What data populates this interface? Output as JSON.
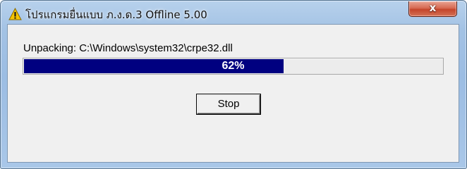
{
  "window": {
    "title": "โปรแกรมยื่นแบบ ภ.ง.ด.3  Offline 5.00",
    "close_label": "x",
    "title_icon": "warning-icon"
  },
  "dialog": {
    "status_text": "Unpacking: C:\\Windows\\system32\\crpe32.dll",
    "progress": {
      "value": 0.62,
      "label": "62%",
      "fill_color": "#000080"
    },
    "stop_label": "Stop"
  }
}
